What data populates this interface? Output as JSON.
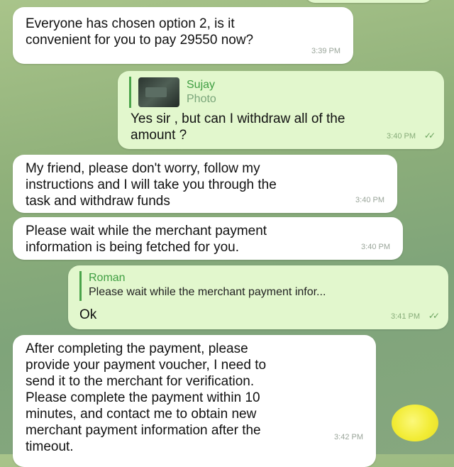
{
  "messages": [
    {
      "id": "m1",
      "direction": "incoming",
      "text_lines": [
        "Everyone has chosen option 2, is it",
        "convenient for you to pay 29550 now?"
      ],
      "time": "3:39 PM"
    },
    {
      "id": "m2",
      "direction": "outgoing",
      "reply_to": {
        "name": "Sujay",
        "content": "Photo"
      },
      "text_lines": [
        "Yes sir , but can I withdraw all of the",
        "amount ?"
      ],
      "time": "3:40 PM"
    },
    {
      "id": "m3",
      "direction": "incoming",
      "text_lines": [
        "My friend, please don't worry, follow my",
        "instructions and I will take you through the",
        "task and withdraw funds"
      ],
      "time": "3:40 PM"
    },
    {
      "id": "m4",
      "direction": "incoming",
      "text_lines": [
        "Please wait while the merchant payment",
        "information is being fetched for you."
      ],
      "time": "3:40 PM"
    },
    {
      "id": "m5",
      "direction": "outgoing",
      "reply_to": {
        "name": "Roman",
        "content": "Please wait while the merchant payment infor..."
      },
      "text_lines": [
        "Ok"
      ],
      "time": "3:41 PM"
    },
    {
      "id": "m6",
      "direction": "incoming",
      "text_lines": [
        "After completing the payment, please",
        "provide your payment voucher, I need to",
        "send it to the merchant for verification.",
        "Please complete the payment within 10",
        "minutes, and contact me to obtain new",
        "merchant payment information after the",
        "timeout."
      ],
      "time": "3:42 PM"
    }
  ],
  "colors": {
    "incoming_bubble": "#ffffff",
    "outgoing_bubble": "#e2f7cd",
    "reply_accent": "#3f9e42",
    "highlight_mark": "#f2ec35"
  },
  "icons": {
    "read_receipt": "double-check-icon",
    "emoji": "yellow-highlight-mark"
  }
}
